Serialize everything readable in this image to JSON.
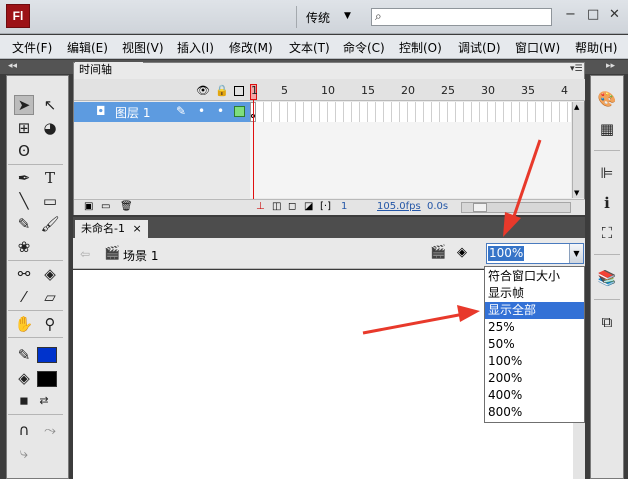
{
  "app": {
    "logo": "Fl",
    "workspace": "传统",
    "search_placeholder": "",
    "window_buttons": {
      "minimize": "−",
      "restore": "□",
      "close": "✕"
    }
  },
  "menu": [
    "文件(F)",
    "编辑(E)",
    "视图(V)",
    "插入(I)",
    "修改(M)",
    "文本(T)",
    "命令(C)",
    "控制(O)",
    "调试(D)",
    "窗口(W)",
    "帮助(H)"
  ],
  "timeline": {
    "tab_label": "时间轴",
    "frame_numbers": [
      "1",
      "5",
      "10",
      "15",
      "20",
      "25",
      "30",
      "35",
      "4"
    ],
    "layer_name": "图层 1",
    "footer": {
      "current_frame": "1",
      "fps": "105.0fps",
      "time": "0.0s"
    }
  },
  "document": {
    "tab_label": "未命名-1",
    "close_glyph": "×",
    "scene_label": "场景 1"
  },
  "zoom": {
    "value": "100%",
    "options": [
      "符合窗口大小",
      "显示帧",
      "显示全部",
      "25%",
      "50%",
      "100%",
      "200%",
      "400%",
      "800%"
    ],
    "highlighted_index": 2
  },
  "colors": {
    "stroke": "#000000",
    "fill": "#0033cc",
    "fill2": "#000000",
    "accent_arrow": "#e8392b",
    "layer_highlight": "#5d9be0"
  }
}
